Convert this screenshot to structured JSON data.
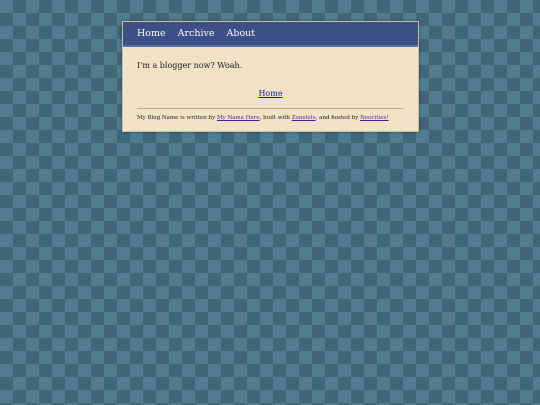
{
  "nav": {
    "items": [
      {
        "label": "Home"
      },
      {
        "label": "Archive"
      },
      {
        "label": "About"
      }
    ]
  },
  "post": {
    "text": "I'm a blogger now? Woah.",
    "home_link": "Home"
  },
  "footer": {
    "part1": "My Blog Name is written by ",
    "author_link": "My Name Here",
    "part2": ", built with ",
    "zonelets_link": "Zonelets",
    "part3": ", and hosted by ",
    "neocities_link": "Neocities!"
  },
  "colors": {
    "background": "#4f7d8f",
    "navbar": "#3c4f86",
    "content": "#f2e3c4"
  }
}
